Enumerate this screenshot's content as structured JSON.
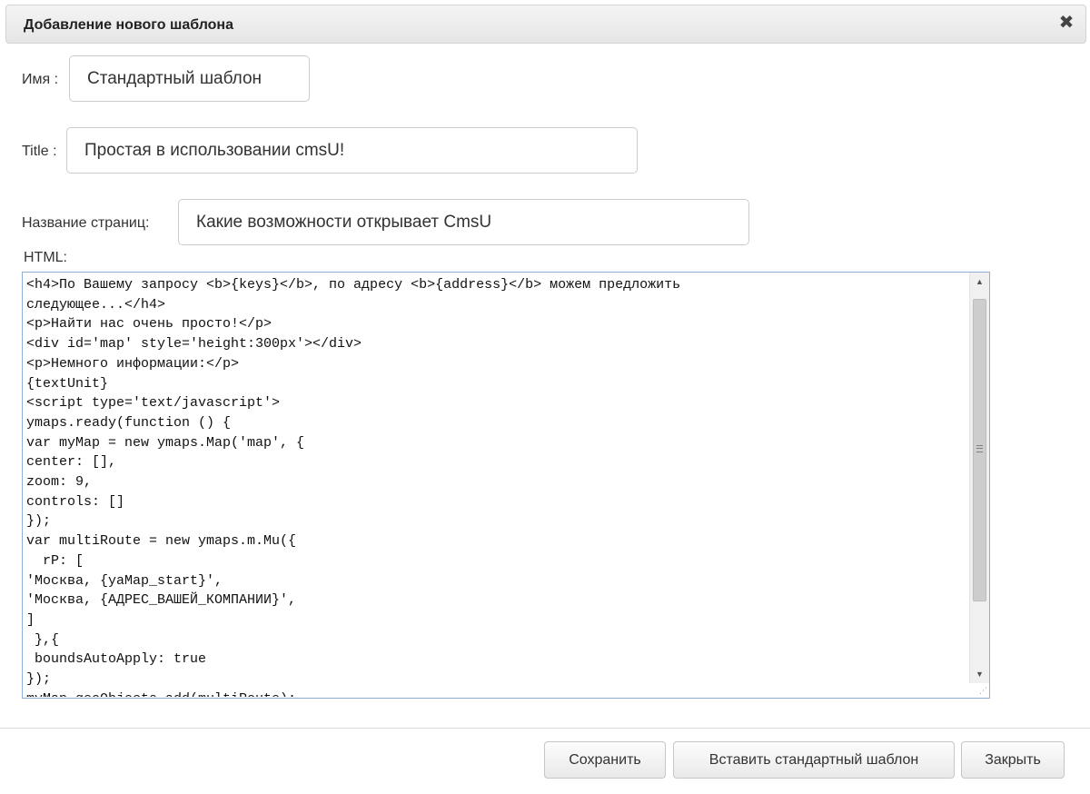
{
  "dialog": {
    "title": "Добавление нового шаблона",
    "close_glyph": "✖",
    "close_icon": "close-icon"
  },
  "form": {
    "name": {
      "label": "Имя :",
      "value": "Стандартный шаблон"
    },
    "title": {
      "label": "Title :",
      "value": "Простая в использовании cmsU!"
    },
    "page_name": {
      "label": "Название страниц:",
      "value": "Какие возможности открывает CmsU"
    },
    "html": {
      "label": "HTML:",
      "lines": [
        "<h4>По Вашему запросу <b>{keys}</b>, по адресу <b>{address}</b> можем предложить",
        "следующее...</h4>",
        "<p>Найти нас очень просто!</p>",
        "<div id='map' style='height:300px'></div>",
        "<p>Немного информации:</p>",
        "{textUnit}",
        "<script type='text/javascript'>",
        "ymaps.ready(function () {",
        "var myMap = new ymaps.Map('map', {",
        "center: [],",
        "zoom: 9,",
        "controls: []",
        "});",
        "var multiRoute = new ymaps.m.Mu({",
        "  rP: [",
        "'Москва, {yaMap_start}',",
        "'Москва, {АДРЕС_ВАШЕЙ_КОМПАНИИ}',",
        "]",
        " },{",
        " boundsAutoApply: true",
        "});",
        "myMap.geoObjects.add(multiRoute);"
      ]
    }
  },
  "scrollbar": {
    "up_glyph": "▲",
    "down_glyph": "▼",
    "resize_glyph": "⋰"
  },
  "footer": {
    "save_label": "Сохранить",
    "insert_default_label": "Вставить стандартный шаблон",
    "close_label": "Закрыть"
  }
}
